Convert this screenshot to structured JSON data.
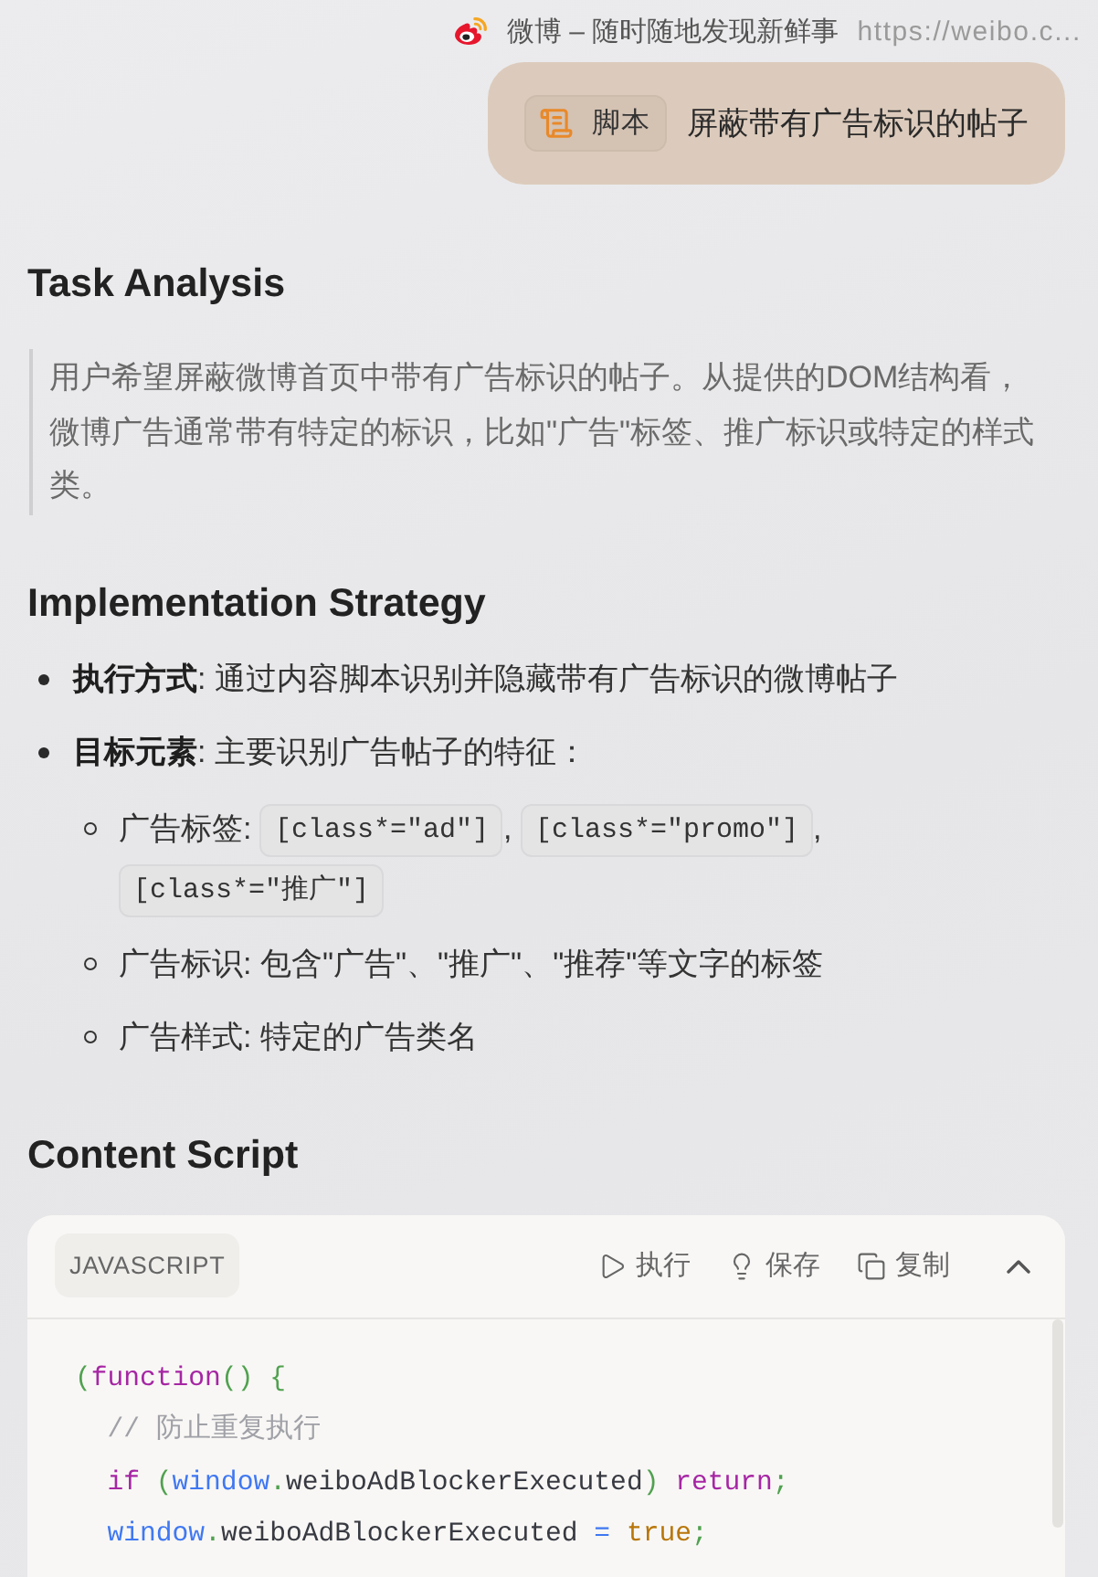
{
  "browser_tab": {
    "site_title": "微博 – 随时随地发现新鲜事",
    "url": "https://weibo.c..."
  },
  "user_message": {
    "tag_label": "脚本",
    "text": "屏蔽带有广告标识的帖子"
  },
  "sections": [
    {
      "kind": "quote",
      "heading": "Task Analysis",
      "text": "用户希望屏蔽微博首页中带有广告标识的帖子。从提供的DOM结构看，微博广告通常带有特定的标识，比如\"广告\"标签、推广标识或特定的样式类。"
    },
    {
      "kind": "list",
      "heading": "Implementation Strategy",
      "items": [
        {
          "text": "**执行方式**: 通过内容脚本识别并隐藏带有广告标识的微博帖子"
        },
        {
          "text": "**目标元素**: 主要识别广告帖子的特征：",
          "children": [
            {
              "segments": [
                {
                  "kind": "text",
                  "text": "广告标签: "
                },
                {
                  "kind": "code",
                  "text": "[class*=\"ad\"]"
                },
                {
                  "kind": "text",
                  "text": ", "
                },
                {
                  "kind": "code",
                  "text": "[class*=\"promo\"]"
                },
                {
                  "kind": "text",
                  "text": ", "
                },
                {
                  "kind": "code",
                  "text": "[class*=\"推广\"]"
                }
              ]
            },
            {
              "segments": [
                {
                  "kind": "text",
                  "text": "广告标识: 包含\"广告\"、\"推广\"、\"推荐\"等文字的标签"
                }
              ]
            },
            {
              "segments": [
                {
                  "kind": "text",
                  "text": "广告样式: 特定的广告类名"
                }
              ]
            }
          ]
        }
      ]
    },
    {
      "kind": "code",
      "heading": "Content Script",
      "code": {
        "language": "JAVASCRIPT",
        "expanded": true,
        "actions": [
          {
            "kind": "run",
            "label": "执行"
          },
          {
            "kind": "save",
            "label": "保存"
          },
          {
            "kind": "copy",
            "label": "复制"
          }
        ],
        "lines": [
          {
            "tokens": [
              {
                "kind": "punct",
                "text": "("
              },
              {
                "kind": "keyword",
                "text": "function"
              },
              {
                "kind": "punct",
                "text": "() {"
              }
            ]
          },
          {
            "tokens": [
              {
                "kind": "comment",
                "text": "  // 防止重复执行"
              }
            ]
          },
          {
            "tokens": [
              {
                "kind": "keyword",
                "text": "  if"
              },
              {
                "kind": "punct",
                "text": " ("
              },
              {
                "kind": "builtin",
                "text": "window"
              },
              {
                "kind": "punct",
                "text": "."
              },
              {
                "kind": "plain",
                "text": "weiboAdBlockerExecuted"
              },
              {
                "kind": "punct",
                "text": ")"
              },
              {
                "kind": "keyword",
                "text": " return"
              },
              {
                "kind": "punct",
                "text": ";"
              }
            ]
          },
          {
            "tokens": [
              {
                "kind": "builtin",
                "text": "  window"
              },
              {
                "kind": "punct",
                "text": "."
              },
              {
                "kind": "plain",
                "text": "weiboAdBlockerExecuted "
              },
              {
                "kind": "operator",
                "text": "= "
              },
              {
                "kind": "boolean",
                "text": "true"
              },
              {
                "kind": "punct",
                "text": ";"
              }
            ]
          }
        ]
      }
    }
  ]
}
